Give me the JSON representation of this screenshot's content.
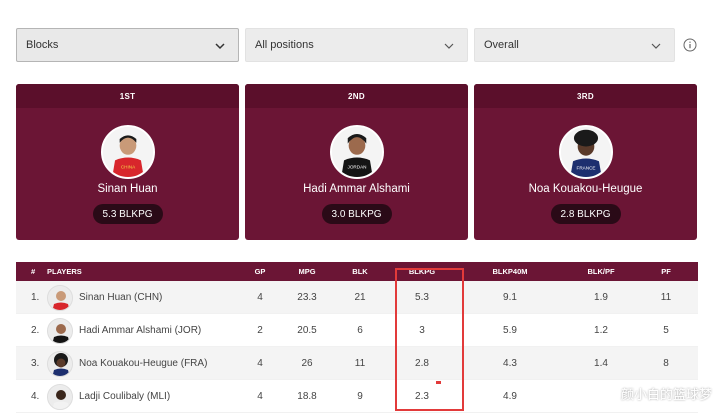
{
  "filters": {
    "stat": "Blocks",
    "position": "All positions",
    "scope": "Overall"
  },
  "podium": [
    {
      "rank": "1ST",
      "name": "Sinan Huan",
      "stat": "5.3 BLKPG",
      "jersey": "CHINA"
    },
    {
      "rank": "2ND",
      "name": "Hadi Ammar Alshami",
      "stat": "3.0 BLKPG",
      "jersey": "JORDAN"
    },
    {
      "rank": "3RD",
      "name": "Noa Kouakou-Heugue",
      "stat": "2.8 BLKPG",
      "jersey": "FRANCE"
    }
  ],
  "table": {
    "headers": [
      "#",
      "PLAYERS",
      "GP",
      "MPG",
      "BLK",
      "BLKPG",
      "BLKP40M",
      "BLK/PF",
      "PF"
    ],
    "rows": [
      {
        "rank": "1.",
        "player": "Sinan Huan (CHN)",
        "gp": "4",
        "mpg": "23.3",
        "blk": "21",
        "blkpg": "5.3",
        "blkp40m": "9.1",
        "blkpf": "1.9",
        "pf": "11"
      },
      {
        "rank": "2.",
        "player": "Hadi Ammar Alshami (JOR)",
        "gp": "2",
        "mpg": "20.5",
        "blk": "6",
        "blkpg": "3",
        "blkp40m": "5.9",
        "blkpf": "1.2",
        "pf": "5"
      },
      {
        "rank": "3.",
        "player": "Noa Kouakou-Heugue (FRA)",
        "gp": "4",
        "mpg": "26",
        "blk": "11",
        "blkpg": "2.8",
        "blkp40m": "4.3",
        "blkpf": "1.4",
        "pf": "8"
      },
      {
        "rank": "4.",
        "player": "Ladji Coulibaly (MLI)",
        "gp": "4",
        "mpg": "18.8",
        "blk": "9",
        "blkpg": "2.3",
        "blkp40m": "4.9",
        "blkpf": "",
        "pf": ""
      }
    ]
  },
  "watermark": "颜小白的篮球梦",
  "colors": {
    "brand": "#6b1535",
    "brand_dark": "#5b0f2b",
    "pill": "#2a0a17",
    "highlight": "#e23a3a"
  }
}
